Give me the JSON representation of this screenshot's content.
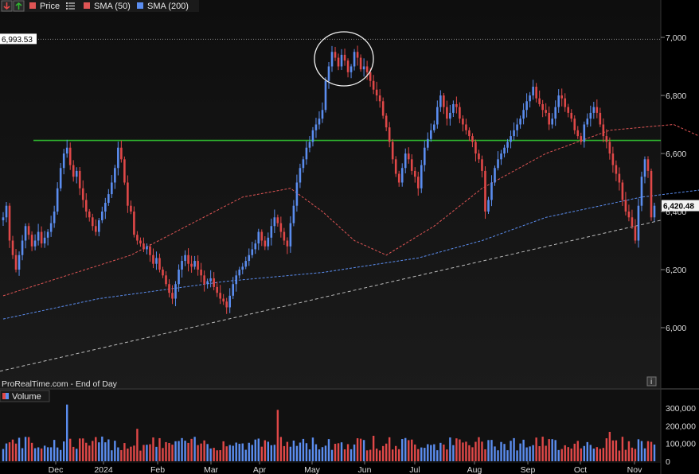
{
  "legend": {
    "items": [
      {
        "id": "price",
        "label": "Price",
        "color": "#e05555"
      },
      {
        "id": "sma50",
        "label": "SMA (50)",
        "color": "#e05555"
      },
      {
        "id": "sma200",
        "label": "SMA (200)",
        "color": "#5b8def"
      }
    ],
    "icons": [
      "down-arrow-icon",
      "up-arrow-icon",
      "settings-list-icon"
    ]
  },
  "branding": "ProRealTime.com - End of Day",
  "info_icon": "i",
  "volume_panel": {
    "label": "Volume"
  },
  "colors": {
    "up": "#5b8def",
    "down": "#e04848",
    "resistance": "#2fb52f",
    "trend": "#bbbbbb",
    "sma50": "#e05555",
    "sma200": "#5b8def",
    "background": "#000000"
  },
  "chart_data": {
    "type": "candlestick",
    "price_axis": {
      "ticks": [
        6000,
        6200,
        6400,
        6600,
        6800,
        7000
      ],
      "labels": [
        "6,000",
        "6,200",
        "6,400",
        "6,600",
        "6,800",
        "7,000"
      ],
      "range": [
        5840,
        7120
      ]
    },
    "time_axis": {
      "labels": [
        "Dec",
        "2024",
        "Feb",
        "Mar",
        "Apr",
        "May",
        "Jun",
        "Jul",
        "Aug",
        "Sep",
        "Oct",
        "Nov"
      ]
    },
    "high_marker": {
      "value": 6993.53,
      "label": "6,993.53"
    },
    "last_price": {
      "value": 6420.48,
      "label": "6,420.48"
    },
    "resistance_level": 6645,
    "trendline": {
      "start": 5850,
      "end": 6370
    },
    "closes": [
      6380,
      6420,
      6300,
      6250,
      6200,
      6250,
      6300,
      6350,
      6320,
      6280,
      6300,
      6330,
      6290,
      6310,
      6330,
      6360,
      6400,
      6480,
      6550,
      6600,
      6620,
      6560,
      6520,
      6540,
      6480,
      6440,
      6400,
      6380,
      6350,
      6330,
      6370,
      6400,
      6430,
      6460,
      6500,
      6550,
      6620,
      6580,
      6500,
      6420,
      6400,
      6320,
      6300,
      6290,
      6270,
      6280,
      6250,
      6220,
      6240,
      6200,
      6180,
      6150,
      6120,
      6100,
      6150,
      6200,
      6230,
      6250,
      6220,
      6210,
      6230,
      6200,
      6180,
      6150,
      6160,
      6170,
      6140,
      6120,
      6100,
      6090,
      6070,
      6110,
      6150,
      6180,
      6200,
      6210,
      6230,
      6250,
      6270,
      6290,
      6330,
      6300,
      6280,
      6310,
      6350,
      6380,
      6360,
      6330,
      6300,
      6280,
      6360,
      6420,
      6500,
      6550,
      6580,
      6620,
      6640,
      6680,
      6700,
      6720,
      6750,
      6850,
      6900,
      6950,
      6930,
      6900,
      6940,
      6920,
      6880,
      6900,
      6950,
      6930,
      6890,
      6900,
      6880,
      6850,
      6820,
      6800,
      6780,
      6730,
      6690,
      6640,
      6580,
      6530,
      6500,
      6550,
      6600,
      6580,
      6540,
      6520,
      6480,
      6560,
      6620,
      6650,
      6680,
      6700,
      6760,
      6800,
      6760,
      6720,
      6740,
      6770,
      6760,
      6720,
      6700,
      6680,
      6660,
      6640,
      6600,
      6580,
      6540,
      6400,
      6440,
      6500,
      6550,
      6580,
      6600,
      6620,
      6640,
      6660,
      6680,
      6700,
      6720,
      6750,
      6780,
      6800,
      6830,
      6790,
      6770,
      6750,
      6740,
      6700,
      6720,
      6760,
      6800,
      6790,
      6760,
      6740,
      6720,
      6680,
      6660,
      6640,
      6700,
      6720,
      6740,
      6760,
      6740,
      6700,
      6660,
      6640,
      6600,
      6560,
      6530,
      6500,
      6440,
      6400,
      6380,
      6350,
      6300,
      6420,
      6520,
      6580,
      6540,
      6380,
      6420
    ],
    "sma50": {
      "name": "SMA (50)",
      "start": 6110,
      "path_points": [
        [
          0,
          6110
        ],
        [
          40,
          6250
        ],
        [
          75,
          6450
        ],
        [
          90,
          6480
        ],
        [
          100,
          6400
        ],
        [
          110,
          6300
        ],
        [
          120,
          6250
        ],
        [
          135,
          6350
        ],
        [
          150,
          6480
        ],
        [
          170,
          6600
        ],
        [
          190,
          6680
        ],
        [
          210,
          6700
        ],
        [
          220,
          6650
        ],
        [
          240,
          6560
        ],
        [
          250,
          6550
        ],
        [
          260,
          6640
        ],
        [
          280,
          6700
        ],
        [
          300,
          6720
        ],
        [
          320,
          6680
        ],
        [
          334,
          6645
        ]
      ]
    },
    "sma200": {
      "name": "SMA (200)",
      "path_points": [
        [
          0,
          6030
        ],
        [
          30,
          6100
        ],
        [
          70,
          6160
        ],
        [
          100,
          6190
        ],
        [
          130,
          6240
        ],
        [
          150,
          6300
        ],
        [
          170,
          6380
        ],
        [
          200,
          6450
        ],
        [
          230,
          6490
        ],
        [
          260,
          6530
        ],
        [
          290,
          6560
        ],
        [
          310,
          6570
        ],
        [
          334,
          6575
        ]
      ]
    },
    "volume_axis": {
      "ticks": [
        0,
        100000,
        200000,
        300000
      ],
      "labels": [
        "0",
        "100,000",
        "200,000",
        "300,000"
      ],
      "max": 350000
    }
  }
}
